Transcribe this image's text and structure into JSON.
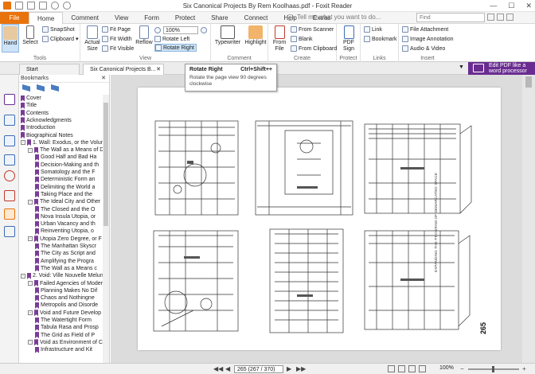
{
  "window": {
    "title": "Six Canonical Projects By Rem Koolhaas.pdf - Foxit Reader"
  },
  "ribbon_tabs": [
    "File",
    "Home",
    "Comment",
    "View",
    "Form",
    "Protect",
    "Share",
    "Connect",
    "Help",
    "Extras"
  ],
  "active_tab": "Home",
  "tell_me": "Tell me what you want to do...",
  "find_placeholder": "Find",
  "groups": {
    "tools": {
      "label": "Tools",
      "hand": "Hand",
      "select": "Select",
      "snapshot": "SnapShot",
      "clipboard": "Clipboard"
    },
    "view": {
      "label": "View",
      "actual_size": "Actual Size",
      "fit_page": "Fit Page",
      "fit_width": "Fit Width",
      "fit_visible": "Fit Visible",
      "reflow": "Reflow",
      "zoom": "100%",
      "rotate_left": "Rotate Left",
      "rotate_right": "Rotate Right"
    },
    "comment": {
      "label": "Comment",
      "typewriter": "Typewriter",
      "highlight": "Highlight"
    },
    "create": {
      "label": "Create",
      "from_file": "From File",
      "from_scanner": "From Scanner",
      "blank": "Blank",
      "from_clipboard": "From Clipboard"
    },
    "protect": {
      "label": "Protect",
      "pdf_sign": "PDF Sign"
    },
    "links": {
      "label": "Links",
      "link": "Link",
      "bookmark": "Bookmark"
    },
    "insert": {
      "label": "Insert",
      "file_attachment": "File Attachment",
      "image_annotation": "Image Annotation",
      "audio_video": "Audio & Video"
    }
  },
  "doc_tabs": {
    "start": "Start",
    "doc": "Six Canonical Projects B..."
  },
  "promo": "Edit PDF like a word processor",
  "tooltip": {
    "title": "Rotate Right",
    "shortcut": "Ctrl+Shift++",
    "desc": "Rotate the page view 90 degrees clockwise"
  },
  "bookmarks_title": "Bookmarks",
  "bookmarks": [
    {
      "t": "Cover",
      "l": 0
    },
    {
      "t": "Title",
      "l": 0
    },
    {
      "t": "Contents",
      "l": 0
    },
    {
      "t": "Acknowledgments",
      "l": 0
    },
    {
      "t": "Introduction",
      "l": 0
    },
    {
      "t": "Biographical Notes",
      "l": 0
    },
    {
      "t": "1. Wall: Exodus, or the Volun",
      "l": 0,
      "tg": "-"
    },
    {
      "t": "The Wall as a Means of D",
      "l": 1,
      "tg": "-"
    },
    {
      "t": "Good Half and Bad Ha",
      "l": 2
    },
    {
      "t": "Decision-Making and th",
      "l": 2
    },
    {
      "t": "Somatology and the F",
      "l": 2
    },
    {
      "t": "Deterministic Form an",
      "l": 2
    },
    {
      "t": "Delimiting the World a",
      "l": 2
    },
    {
      "t": "Taking Place and the",
      "l": 2
    },
    {
      "t": "The Ideal City and Other",
      "l": 1,
      "tg": "-"
    },
    {
      "t": "The Closed and the O",
      "l": 2
    },
    {
      "t": "Nova Insula Utopia, or",
      "l": 2
    },
    {
      "t": "Urban Vacancy and th",
      "l": 2
    },
    {
      "t": "Reinventing Utopia, o",
      "l": 2
    },
    {
      "t": "Utopia Zero Degree, or F",
      "l": 1,
      "tg": "-"
    },
    {
      "t": "The Manhattan Skyscr",
      "l": 2
    },
    {
      "t": "The City as Script and",
      "l": 2
    },
    {
      "t": "Amplifying the Progra",
      "l": 2
    },
    {
      "t": "The Wall as a Means c",
      "l": 2
    },
    {
      "t": "2. Void: Ville Nouvelle Melun-",
      "l": 0,
      "tg": "-"
    },
    {
      "t": "Failed Agencies of Modern",
      "l": 1,
      "tg": "-"
    },
    {
      "t": "Planning Makes No Dif",
      "l": 2
    },
    {
      "t": "Chaos and Nothingne",
      "l": 2
    },
    {
      "t": "Metropolis and Disorde",
      "l": 2
    },
    {
      "t": "Void and Future Develop",
      "l": 1,
      "tg": "-"
    },
    {
      "t": "The Watertight Form",
      "l": 2
    },
    {
      "t": "Tabula Rasa and Prosp",
      "l": 2
    },
    {
      "t": "The Grid as Field of P",
      "l": 2
    },
    {
      "t": "Void as Environment of C",
      "l": 1,
      "tg": "-"
    },
    {
      "t": "Infrastructure and Kit",
      "l": 2
    }
  ],
  "page": {
    "number": "265",
    "caption": "EXPANDING THE PROGRAM OF DEMARCATED SPACE"
  },
  "status": {
    "page_box": "265 (267 / 370)",
    "zoom": "100%"
  }
}
